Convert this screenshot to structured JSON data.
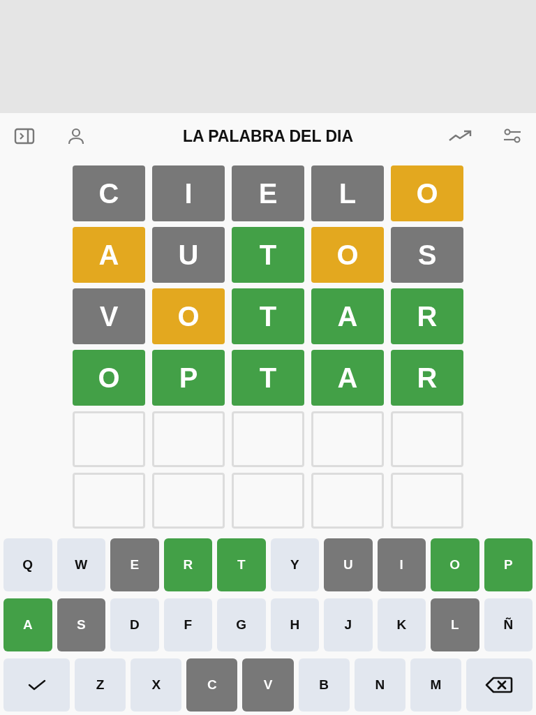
{
  "header": {
    "title": "LA PALABRA DEL DIA"
  },
  "board": [
    [
      {
        "letter": "C",
        "color": "#787878"
      },
      {
        "letter": "I",
        "color": "#787878"
      },
      {
        "letter": "E",
        "color": "#787878"
      },
      {
        "letter": "L",
        "color": "#787878"
      },
      {
        "letter": "O",
        "color": "#e3a81f"
      }
    ],
    [
      {
        "letter": "A",
        "color": "#e3a81f"
      },
      {
        "letter": "U",
        "color": "#787878"
      },
      {
        "letter": "T",
        "color": "#43a047"
      },
      {
        "letter": "O",
        "color": "#e3a81f"
      },
      {
        "letter": "S",
        "color": "#787878"
      }
    ],
    [
      {
        "letter": "V",
        "color": "#787878"
      },
      {
        "letter": "O",
        "color": "#e3a81f"
      },
      {
        "letter": "T",
        "color": "#43a047"
      },
      {
        "letter": "A",
        "color": "#43a047"
      },
      {
        "letter": "R",
        "color": "#43a047"
      }
    ],
    [
      {
        "letter": "O",
        "color": "#43a047"
      },
      {
        "letter": "P",
        "color": "#43a047"
      },
      {
        "letter": "T",
        "color": "#43a047"
      },
      {
        "letter": "A",
        "color": "#43a047"
      },
      {
        "letter": "R",
        "color": "#43a047"
      }
    ],
    [
      {
        "filled": false
      },
      {
        "filled": false
      },
      {
        "filled": false
      },
      {
        "filled": false
      },
      {
        "filled": false
      }
    ],
    [
      {
        "filled": false
      },
      {
        "filled": false
      },
      {
        "filled": false
      },
      {
        "filled": false
      },
      {
        "filled": false
      }
    ]
  ],
  "keyboard": [
    [
      {
        "kind": "letter",
        "label": "Q"
      },
      {
        "kind": "letter",
        "label": "W"
      },
      {
        "kind": "letter",
        "label": "E",
        "color": "#787878"
      },
      {
        "kind": "letter",
        "label": "R",
        "color": "#43a047"
      },
      {
        "kind": "letter",
        "label": "T",
        "color": "#43a047"
      },
      {
        "kind": "letter",
        "label": "Y"
      },
      {
        "kind": "letter",
        "label": "U",
        "color": "#787878"
      },
      {
        "kind": "letter",
        "label": "I",
        "color": "#787878"
      },
      {
        "kind": "letter",
        "label": "O",
        "color": "#43a047"
      },
      {
        "kind": "letter",
        "label": "P",
        "color": "#43a047"
      }
    ],
    [
      {
        "kind": "letter",
        "label": "A",
        "color": "#43a047"
      },
      {
        "kind": "letter",
        "label": "S",
        "color": "#787878"
      },
      {
        "kind": "letter",
        "label": "D"
      },
      {
        "kind": "letter",
        "label": "F"
      },
      {
        "kind": "letter",
        "label": "G"
      },
      {
        "kind": "letter",
        "label": "H"
      },
      {
        "kind": "letter",
        "label": "J"
      },
      {
        "kind": "letter",
        "label": "K"
      },
      {
        "kind": "letter",
        "label": "L",
        "color": "#787878"
      },
      {
        "kind": "letter",
        "label": "Ñ"
      }
    ],
    [
      {
        "kind": "enter"
      },
      {
        "kind": "letter",
        "label": "Z"
      },
      {
        "kind": "letter",
        "label": "X"
      },
      {
        "kind": "letter",
        "label": "C",
        "color": "#787878"
      },
      {
        "kind": "letter",
        "label": "V",
        "color": "#787878"
      },
      {
        "kind": "letter",
        "label": "B"
      },
      {
        "kind": "letter",
        "label": "N"
      },
      {
        "kind": "letter",
        "label": "M"
      },
      {
        "kind": "backspace"
      }
    ]
  ]
}
